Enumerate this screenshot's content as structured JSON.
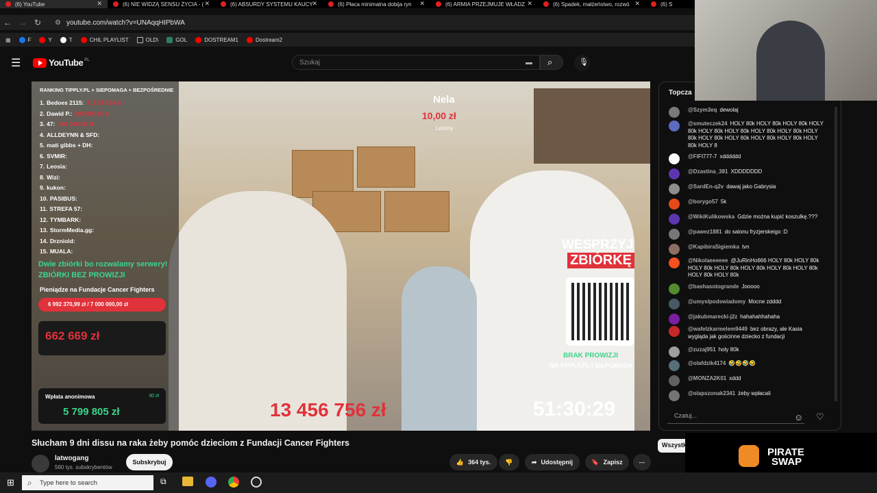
{
  "browser": {
    "tabs": [
      {
        "label": "(6) YouTube",
        "active": true
      },
      {
        "label": "(6) NIE WIDZĄ SENSU ŻYCIA - (",
        "active": false
      },
      {
        "label": "(6) ABSURDY SYSTEMU KAUCY",
        "active": false
      },
      {
        "label": "(6) Płaca minimalna dobija ryn",
        "active": false
      },
      {
        "label": "(6) ARMIA PRZEJMUJE WŁADZ",
        "active": false
      },
      {
        "label": "(6) Spadek, małżeństwo, rozwó",
        "active": false
      },
      {
        "label": "(6) S",
        "active": false
      }
    ],
    "url": "youtube.com/watch?v=UNAqqHIPbWA",
    "bookmarks": [
      "F",
      "Y",
      "T",
      "CHIL PLAYLIST",
      "OLD\\",
      "GOL",
      "DOSTREAM1",
      "Dostream2"
    ]
  },
  "youtube": {
    "logo_text": "YouTube",
    "region": "PL",
    "search_placeholder": "Szukaj",
    "video_title": "Słucham 9 dni dissu na raka żeby pomóc dzieciom z Fundacji Cancer Fighters",
    "channel": "latwogang",
    "subscribers": "560 tys. subskrybentów",
    "subscribe_label": "Subskrybuj",
    "likes": "364 tys.",
    "share_label": "Udostępnij",
    "save_label": "Zapisz",
    "chat_header": "Topcza",
    "chat_input_placeholder": "Czatuj...",
    "filter_chip": "Wszystk"
  },
  "overlay": {
    "ranking_title": "RANKING TIPPLY.PL + SIEPOMAGA + BEZPOŚREDNIE",
    "ranking": [
      {
        "pos": "1.",
        "name": "Bedoes 2115:",
        "value": "717 267,66 zł"
      },
      {
        "pos": "2.",
        "name": "Dawid P.:",
        "value": "200 000,00 zł"
      },
      {
        "pos": "3.",
        "name": "47:",
        "value": "180 000,00 zł"
      },
      {
        "pos": "4.",
        "name": "ALLDEYNN & SFD:",
        "value": ""
      },
      {
        "pos": "5.",
        "name": "mati gibbs + DH:",
        "value": ""
      },
      {
        "pos": "6.",
        "name": "SVMIR:",
        "value": ""
      },
      {
        "pos": "7.",
        "name": "Leosia:",
        "value": ""
      },
      {
        "pos": "8.",
        "name": "Wizi:",
        "value": ""
      },
      {
        "pos": "9.",
        "name": "kukon:",
        "value": ""
      },
      {
        "pos": "10.",
        "name": "PASIBUS:",
        "value": ""
      },
      {
        "pos": "11.",
        "name": "STREFA 57:",
        "value": ""
      },
      {
        "pos": "12.",
        "name": "TYMBARK:",
        "value": ""
      },
      {
        "pos": "13.",
        "name": "StormMedia.gg:",
        "value": ""
      },
      {
        "pos": "14.",
        "name": "Drzniold:",
        "value": ""
      },
      {
        "pos": "15.",
        "name": "MUALA:",
        "value": ""
      }
    ],
    "two_fundraisers": "Dwie zbiórki bo rozwalamy serwery!",
    "no_commission": "ZBIÓRKI BEZ PROWIZJI",
    "money_for": "Pieniądze na Fundacje Cancer Fighters",
    "progress": "6 992 370,99 zł / 7 000 000,00 zł",
    "progress_fraction": 0.9989,
    "foundation_amount": "662 669 zł",
    "anon_label": "Wpłata anonimowa",
    "anon_small": "30 zł",
    "anon_amount": "5 799 805 zł",
    "donor_name": "Nela",
    "donor_amount": "10,00 zł",
    "donor_msg": "Lecimy",
    "support_title": "WESPRZYJ",
    "support_title2": "ZBIÓRKĘ",
    "no_commission_short": "BRAK PROWIZJI",
    "at_sites": "NA TIPPLY.PL I SIEPOMAGA",
    "total": "13 456 756 zł",
    "timer": "51:30:29"
  },
  "chat": [
    {
      "author": "@Szym3eq",
      "text": "dewolaj",
      "color": "#7a7a7a"
    },
    {
      "author": "@smuteczek24",
      "text": "HOLY 80k HOLY 80k HOLY 80k HOLY 80k HOLY 80k HOLY 80k HOLY 80k HOLY 80k HOLY 80k HOLY 80k HOLY 80k HOLY 80k HOLY 80k HOLY 80k HOLY 8",
      "color": "#5c6bc0"
    },
    {
      "author": "@FIFI777-7",
      "text": "xdddddd",
      "color": "#ffffff"
    },
    {
      "author": "@Dzastina_381",
      "text": "XDDDDDDD",
      "color": "#5e35b1"
    },
    {
      "author": "@SardEn-q2v",
      "text": "dawaj jako Gabrysia",
      "color": "#8d8d8d"
    },
    {
      "author": "@borygo57",
      "text": "5k",
      "color": "#e64a19"
    },
    {
      "author": "@WikiKulikowska",
      "text": "Gdzie można kupić koszulkę.???",
      "color": "#5e35b1"
    },
    {
      "author": "@pawez1881",
      "text": "do salonu fryzjerskeigo :D",
      "color": "#777"
    },
    {
      "author": "@KapibiraSigiemka",
      "text": "tvn",
      "color": "#8d6e63"
    },
    {
      "author": "@Nikolaeeeeee",
      "text": "@JuRinHo666 HOLY 80k HOLY 80k HOLY 80k HOLY 80k HOLY 80k HOLY 80k HOLY 80k HOLY 80k HOLY 80k",
      "color": "#f4511e"
    },
    {
      "author": "@bashasotogrande",
      "text": "Jooooo",
      "color": "#558b2f"
    },
    {
      "author": "@umyslpodswiadomy",
      "text": "Mocne zdddd",
      "color": "#455a64"
    },
    {
      "author": "@jakubmarecki-j2z",
      "text": "hahahahhahaha",
      "color": "#7b1fa2"
    },
    {
      "author": "@wafelzkarmelem9449",
      "text": "bez obrazy, ale Kasia wygląda jak gościnne dziecko z fundacji",
      "color": "#c62828"
    },
    {
      "author": "@zuzaj951",
      "text": "holy 80k",
      "color": "#9e9e9e"
    },
    {
      "author": "@olafdzik4174",
      "text": "🤣🤣🤣🤣",
      "color": "#546e7a"
    },
    {
      "author": "@MONZA2K01",
      "text": "xddd",
      "color": "#616161"
    },
    {
      "author": "@olapszonak2341",
      "text": "żeby wpłacali",
      "color": "#757575"
    }
  ],
  "taskbar": {
    "search_placeholder": "Type here to search"
  },
  "ad": {
    "brand_line1": "PIRATE",
    "brand_line2": "SWAP"
  },
  "colors": {
    "accent_red": "#e0323a",
    "youtube_red": "#ff0000",
    "bg": "#0f0f0f"
  }
}
